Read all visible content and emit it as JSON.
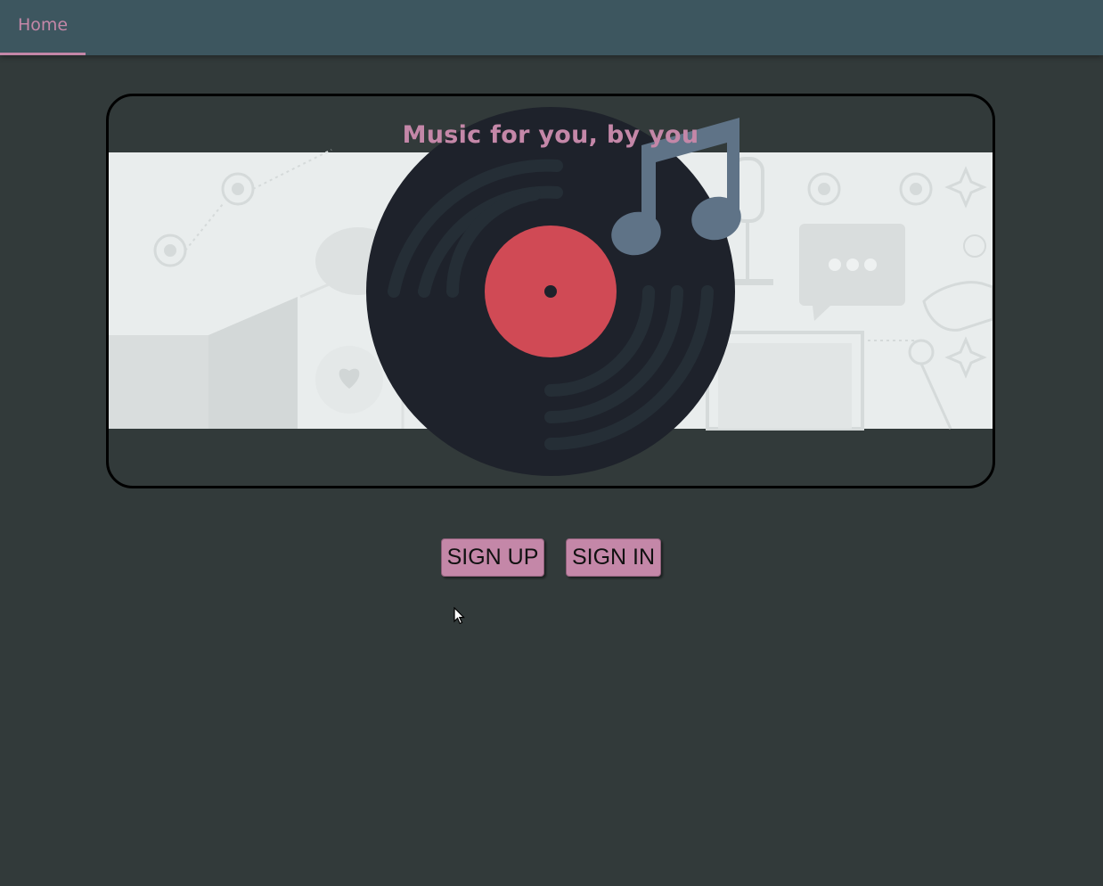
{
  "nav": {
    "home_label": "Home"
  },
  "banner": {
    "title": "Music for you, by you",
    "icons": [
      "vinyl-record-icon",
      "music-note-icon"
    ]
  },
  "actions": {
    "signup_label": "SIGN UP",
    "signin_label": "SIGN IN"
  },
  "colors": {
    "background": "#323a3a",
    "topbar": "#3d565f",
    "accent": "#c487a8",
    "banner_strip": "#e9eded",
    "record": "#1e222b",
    "record_label": "#d04a55",
    "note": "#5f7387"
  }
}
